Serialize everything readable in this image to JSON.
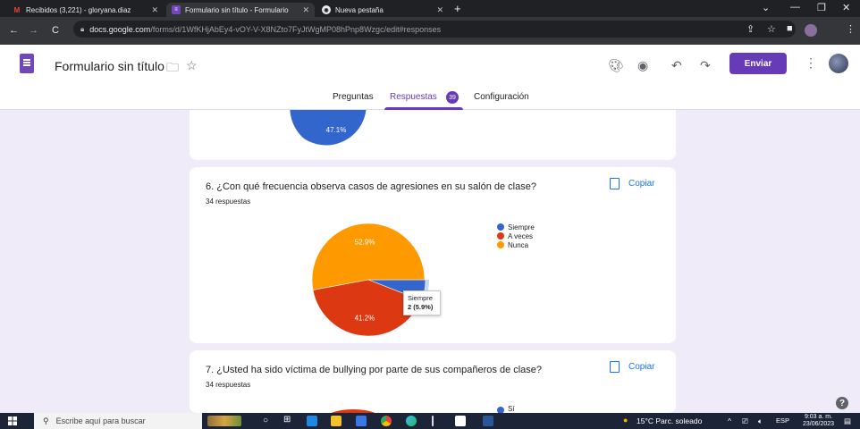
{
  "browser": {
    "tabs": [
      {
        "label": "Recibidos (3,221) - gloryana.diaz",
        "icon": "gmail-icon"
      },
      {
        "label": "Formulario sin título - Formulario",
        "icon": "forms-icon"
      },
      {
        "label": "Nueva pestaña",
        "icon": "chrome-icon"
      }
    ],
    "url_host": "docs.google.com",
    "url_path": "/forms/d/1WfKHjAbEy4-vOY-V-X8NZto7FyJtWgMP08hPnp8Wzgc/edit#responses"
  },
  "form": {
    "title": "Formulario sin título",
    "send_label": "Enviar",
    "tabs": [
      "Preguntas",
      "Respuestas",
      "Configuración"
    ],
    "responses_count": "39"
  },
  "cards": [
    {
      "partial_label": "47.1%"
    },
    {
      "title": "6. ¿Con qué frecuencia observa casos de agresiones en su salón de clase?",
      "count": "34 respuestas",
      "copy_label": "Copiar",
      "legend": [
        "Siempre",
        "A veces",
        "Nunca"
      ],
      "tooltip_name": "Siempre",
      "tooltip_value": "2 (5.9%)"
    },
    {
      "title": "7. ¿Usted ha sido víctima de bullying por parte de sus compañeros de clase?",
      "count": "34 respuestas",
      "copy_label": "Copiar",
      "legend_partial": "Sí"
    }
  ],
  "chart_data": {
    "type": "pie",
    "categories": [
      "Siempre",
      "A veces",
      "Nunca"
    ],
    "values": [
      5.9,
      41.2,
      52.9
    ],
    "counts": [
      2,
      14,
      18
    ],
    "colors": [
      "#3366cc",
      "#dc3912",
      "#ff9900"
    ],
    "slice_labels": [
      "",
      "41.2%",
      "52.9%"
    ],
    "legend_position": "right"
  },
  "taskbar": {
    "search_placeholder": "Escribe aquí para buscar",
    "weather": "15°C  Parc. soleado",
    "lang": "ESP",
    "time": "9:03 a. m.",
    "date": "23/06/2023"
  }
}
